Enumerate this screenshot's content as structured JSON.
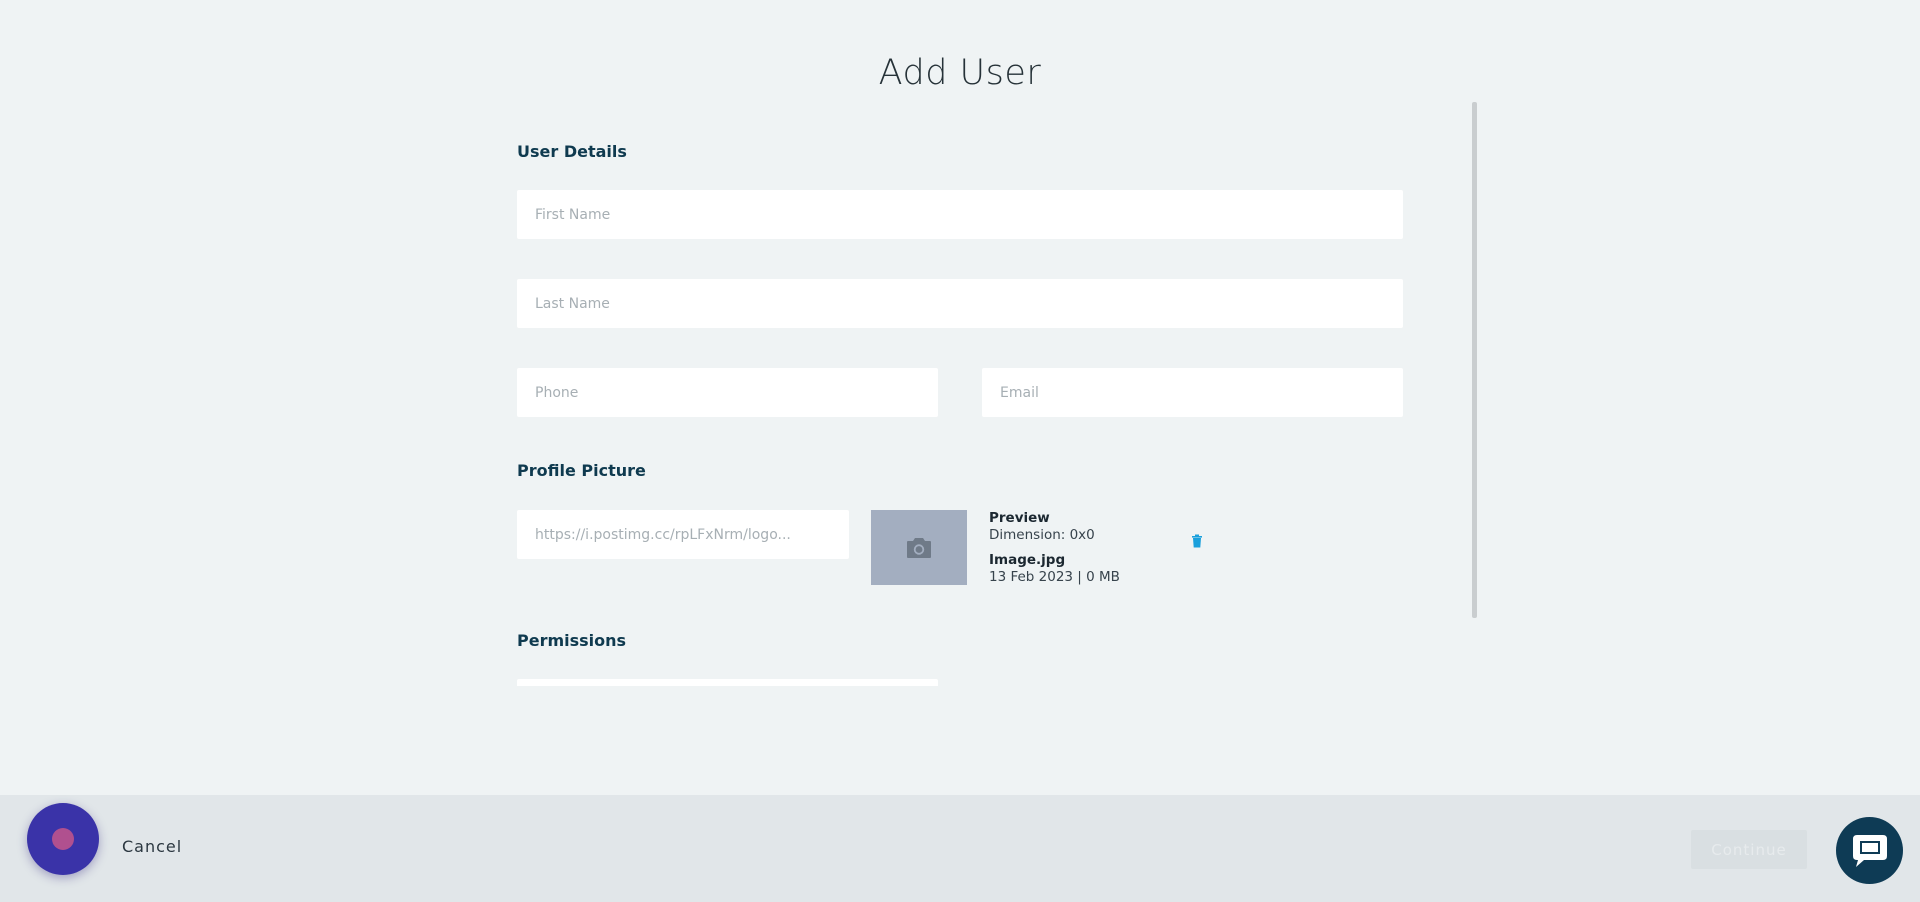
{
  "page": {
    "title": "Add User"
  },
  "sections": {
    "user_details": "User Details",
    "profile_picture": "Profile Picture",
    "permissions": "Permissions"
  },
  "fields": {
    "first_name": {
      "placeholder": "First Name",
      "value": ""
    },
    "last_name": {
      "placeholder": "Last Name",
      "value": ""
    },
    "phone": {
      "placeholder": "Phone",
      "value": ""
    },
    "email": {
      "placeholder": "Email",
      "value": ""
    },
    "image_url": {
      "placeholder": "https://i.postimg.cc/rpLFxNrm/logo...",
      "value": ""
    }
  },
  "preview": {
    "title": "Preview",
    "dimension": "Dimension: 0x0",
    "file_name": "Image.jpg",
    "file_meta": "13 Feb 2023 | 0 MB",
    "icons": {
      "thumbnail": "camera-icon",
      "delete": "trash-icon"
    }
  },
  "footer": {
    "cancel_label": "Cancel",
    "continue_label": "Continue"
  },
  "widgets": {
    "assistant_icon": "assistant-bubble-icon",
    "chat_icon": "chat-icon"
  },
  "colors": {
    "background": "#eff3f4",
    "heading": "#0f3a4f",
    "footer": "#e1e6e9",
    "thumbnail": "#a3aec0",
    "delete_icon": "#1aa0dc",
    "assistant": "#3a33a8",
    "chat": "#0e3b55"
  }
}
